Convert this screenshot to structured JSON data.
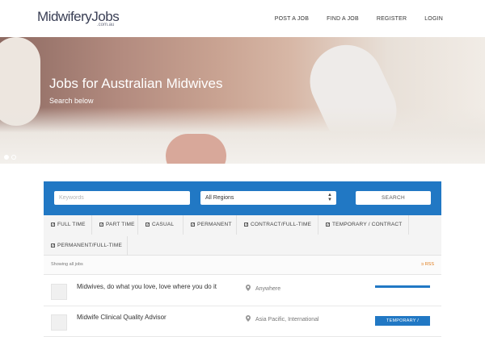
{
  "header": {
    "logo_main": "MidwiferyJobs",
    "logo_sub": ".com.au",
    "nav": [
      "POST A JOB",
      "FIND A JOB",
      "REGISTER",
      "LOGIN"
    ]
  },
  "hero": {
    "title": "Jobs for Australian Midwives",
    "subtitle": "Search below",
    "slides": 2,
    "active_slide": 1
  },
  "search": {
    "keywords_placeholder": "Keywords",
    "region_value": "All Regions",
    "button_label": "SEARCH"
  },
  "filters": [
    "FULL TIME",
    "PART TIME",
    "CASUAL",
    "PERMANENT",
    "CONTRACT/FULL-TIME",
    "TEMPORARY / CONTRACT",
    "PERMANENT/FULL-TIME"
  ],
  "listing": {
    "showing_text": "Showing all jobs",
    "rss_label": "RSS"
  },
  "jobs": [
    {
      "title": "Midwives, do what you love, love where you do it",
      "location": "Anywhere",
      "type": ""
    },
    {
      "title": "Midwife Clinical Quality Advisor",
      "location": "Asia Pacific, International",
      "type": "TEMPORARY /"
    }
  ],
  "colors": {
    "accent": "#2178c4",
    "rss": "#e07b1a"
  }
}
